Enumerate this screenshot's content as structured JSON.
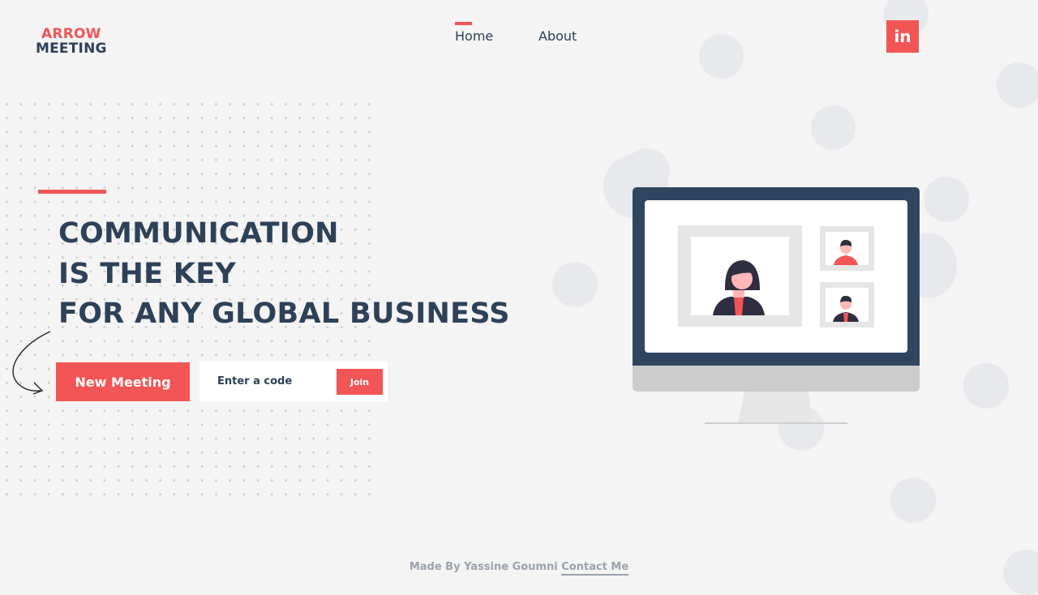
{
  "logo": {
    "line1": "ARROW",
    "line2": "MEETING"
  },
  "nav": {
    "items": [
      {
        "label": "Home",
        "active": true
      },
      {
        "label": "About",
        "active": false
      }
    ]
  },
  "social": {
    "icon": "linkedin-icon",
    "label": "in"
  },
  "hero": {
    "lines": [
      "COMMUNICATION",
      "IS THE KEY",
      "FOR ANY GLOBAL BUSINESS"
    ],
    "new_meeting_label": "New Meeting",
    "code_placeholder": "Enter a code",
    "join_label": "Join"
  },
  "footer": {
    "made_by": "Made By Yassine Goumni",
    "contact_label": "Contact Me"
  },
  "colors": {
    "accent": "#f25555",
    "navy": "#2d4159",
    "background": "#f4f4f4"
  }
}
